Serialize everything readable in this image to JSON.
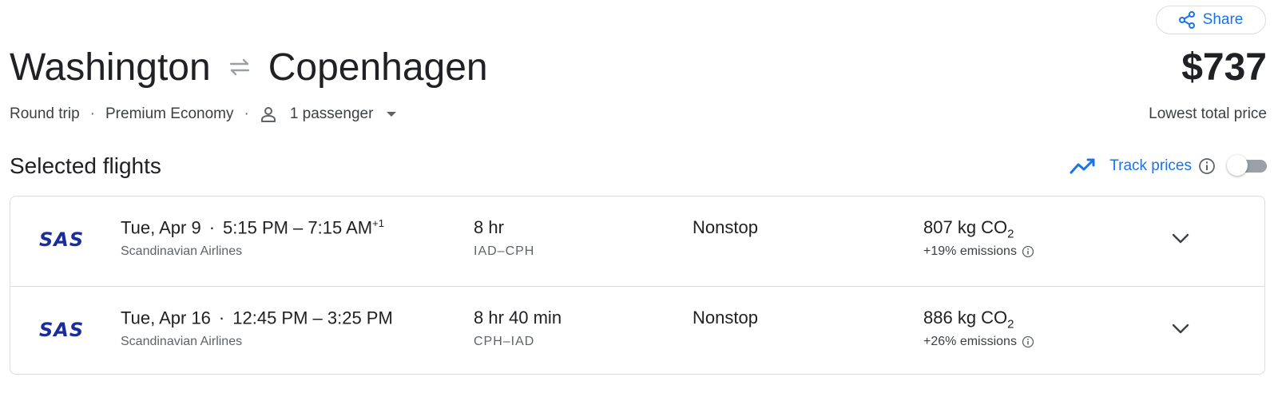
{
  "header": {
    "share_label": "Share",
    "origin": "Washington",
    "destination": "Copenhagen",
    "price": "$737",
    "price_caption": "Lowest total price",
    "trip_type": "Round trip",
    "cabin_class": "Premium Economy",
    "passengers": "1 passenger",
    "separator": "·"
  },
  "selected": {
    "title": "Selected flights",
    "track_prices_label": "Track prices",
    "track_prices_enabled": false
  },
  "flights": [
    {
      "airline_logo": "SAS",
      "date": "Tue, Apr 9",
      "separator": "·",
      "time_range": "5:15 PM – 7:15 AM",
      "day_offset": "+1",
      "airline": "Scandinavian Airlines",
      "duration": "8 hr",
      "route": "IAD–CPH",
      "stops": "Nonstop",
      "co2_value": "807 kg CO",
      "co2_sub": "2",
      "emissions": "+19% emissions"
    },
    {
      "airline_logo": "SAS",
      "date": "Tue, Apr 16",
      "separator": "·",
      "time_range": "12:45 PM – 3:25 PM",
      "day_offset": "",
      "airline": "Scandinavian Airlines",
      "duration": "8 hr 40 min",
      "route": "CPH–IAD",
      "stops": "Nonstop",
      "co2_value": "886 kg CO",
      "co2_sub": "2",
      "emissions": "+26% emissions"
    }
  ],
  "icons": {
    "share": "share-icon",
    "swap": "swap-arrows-icon",
    "person": "person-icon",
    "caret": "caret-down-icon",
    "trend": "trending-up-icon",
    "info": "info-icon",
    "expand": "chevron-down-icon"
  },
  "colors": {
    "accent": "#1a73e8",
    "text": "#202124",
    "secondary_text": "#5f6368",
    "border": "#dadce0",
    "sas_logo": "#1a2d9c",
    "toggle_off": "#9aa0a6"
  }
}
